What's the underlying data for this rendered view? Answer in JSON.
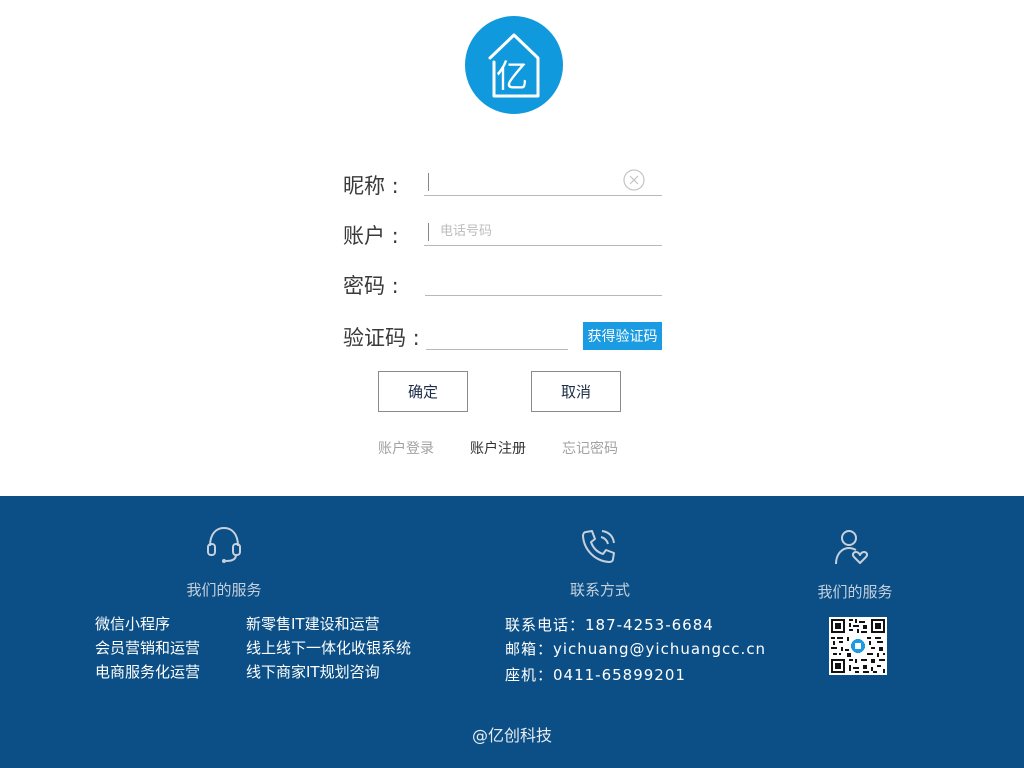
{
  "logo": {
    "glyph": "亿",
    "icon": "house-logo-icon",
    "color": "#1199dd"
  },
  "form": {
    "nickname": {
      "label": "昵称 :",
      "value": "",
      "placeholder": ""
    },
    "account": {
      "label": "账户 :",
      "value": "",
      "placeholder": "电话号码"
    },
    "password": {
      "label": "密码 :",
      "value": "",
      "placeholder": ""
    },
    "captcha": {
      "label": "验证码 :",
      "value": "",
      "placeholder": "",
      "button": "获得验证码"
    },
    "confirm": "确定",
    "cancel": "取消"
  },
  "links": {
    "login": "账户登录",
    "register": "账户注册",
    "forgot": "忘记密码"
  },
  "footer": {
    "background": "#0b4f86",
    "services": {
      "heading": "我们的服务",
      "icon": "headset-icon",
      "col1": [
        "微信小程序",
        "会员营销和运营",
        "电商服务化运营"
      ],
      "col2": [
        "新零售IT建设和运营",
        "线上线下一体化收银系统",
        "线下商家IT规划咨询"
      ]
    },
    "contact": {
      "heading": "联系方式",
      "icon": "phone-icon",
      "phone": "联系电话：187-4253-6684",
      "email": "邮箱：yichuang@yichuangcc.cn",
      "landline": "座机：0411-65899201"
    },
    "service2": {
      "heading": "我们的服务",
      "icon": "user-heart-icon"
    },
    "copyright": "@亿创科技"
  },
  "colors": {
    "accent": "#1a9be2",
    "footer": "#0b4f86"
  }
}
